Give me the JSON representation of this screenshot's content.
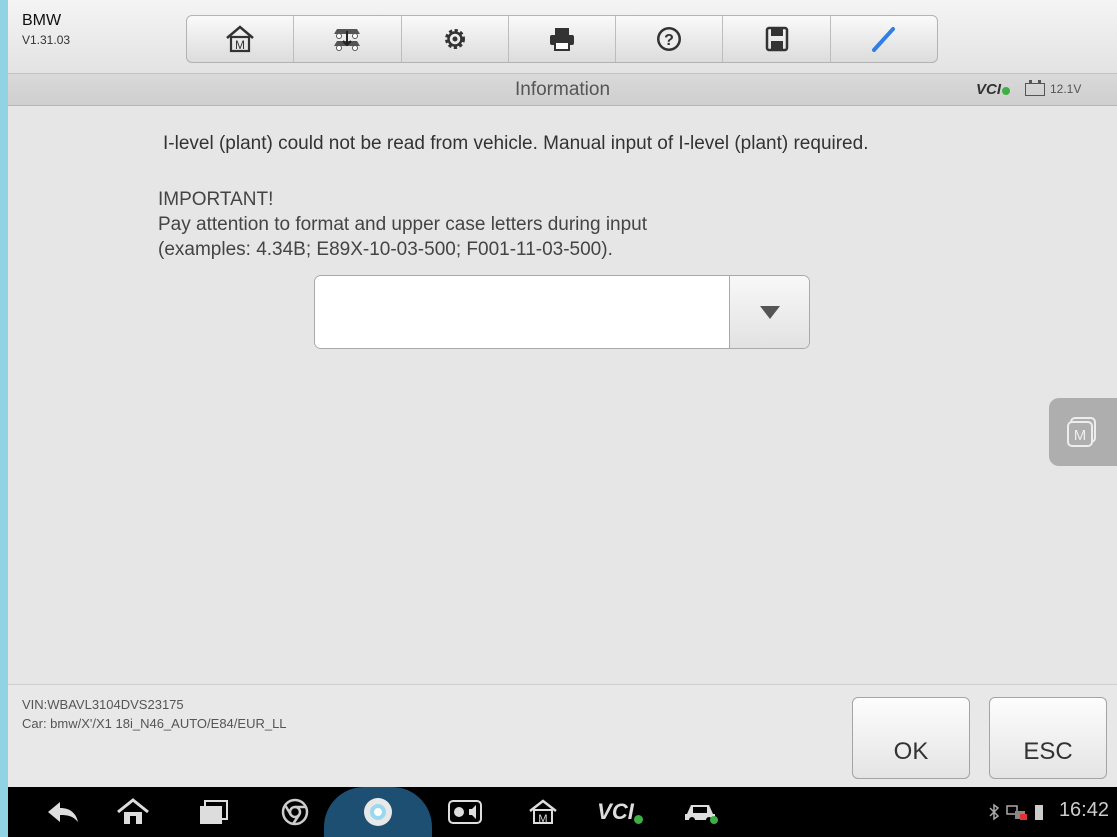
{
  "header": {
    "brand": "BMW",
    "version": "V1.31.03",
    "toolbar": [
      {
        "icon": "home-icon"
      },
      {
        "icon": "vehicle-swap-icon"
      },
      {
        "icon": "gear-icon"
      },
      {
        "icon": "printer-icon"
      },
      {
        "icon": "help-icon"
      },
      {
        "icon": "save-icon"
      },
      {
        "icon": "pen-icon"
      }
    ]
  },
  "titlebar": {
    "title": "Information",
    "vci_label": "VCI",
    "battery_voltage": "12.1V"
  },
  "main": {
    "message": "I-level (plant) could not be read from vehicle. Manual input of I-level (plant) required.",
    "important_heading": "IMPORTANT!",
    "important_line1": "Pay attention to format and upper case letters during input",
    "important_line2": "(examples: 4.34B; E89X-10-03-500; F001-11-03-500).",
    "ilevel_value": ""
  },
  "footer": {
    "vin": "VIN:WBAVL3104DVS23175",
    "car": "Car: bmw/X'/X1 18i_N46_AUTO/E84/EUR_LL",
    "ok_label": "OK",
    "esc_label": "ESC"
  },
  "system_bar": {
    "time": "16:42",
    "vci_label": "VCI"
  },
  "colors": {
    "accent_blue": "#2f7fe6",
    "vci_green": "#3cb043",
    "outer_bg": "#8fd3e4"
  }
}
